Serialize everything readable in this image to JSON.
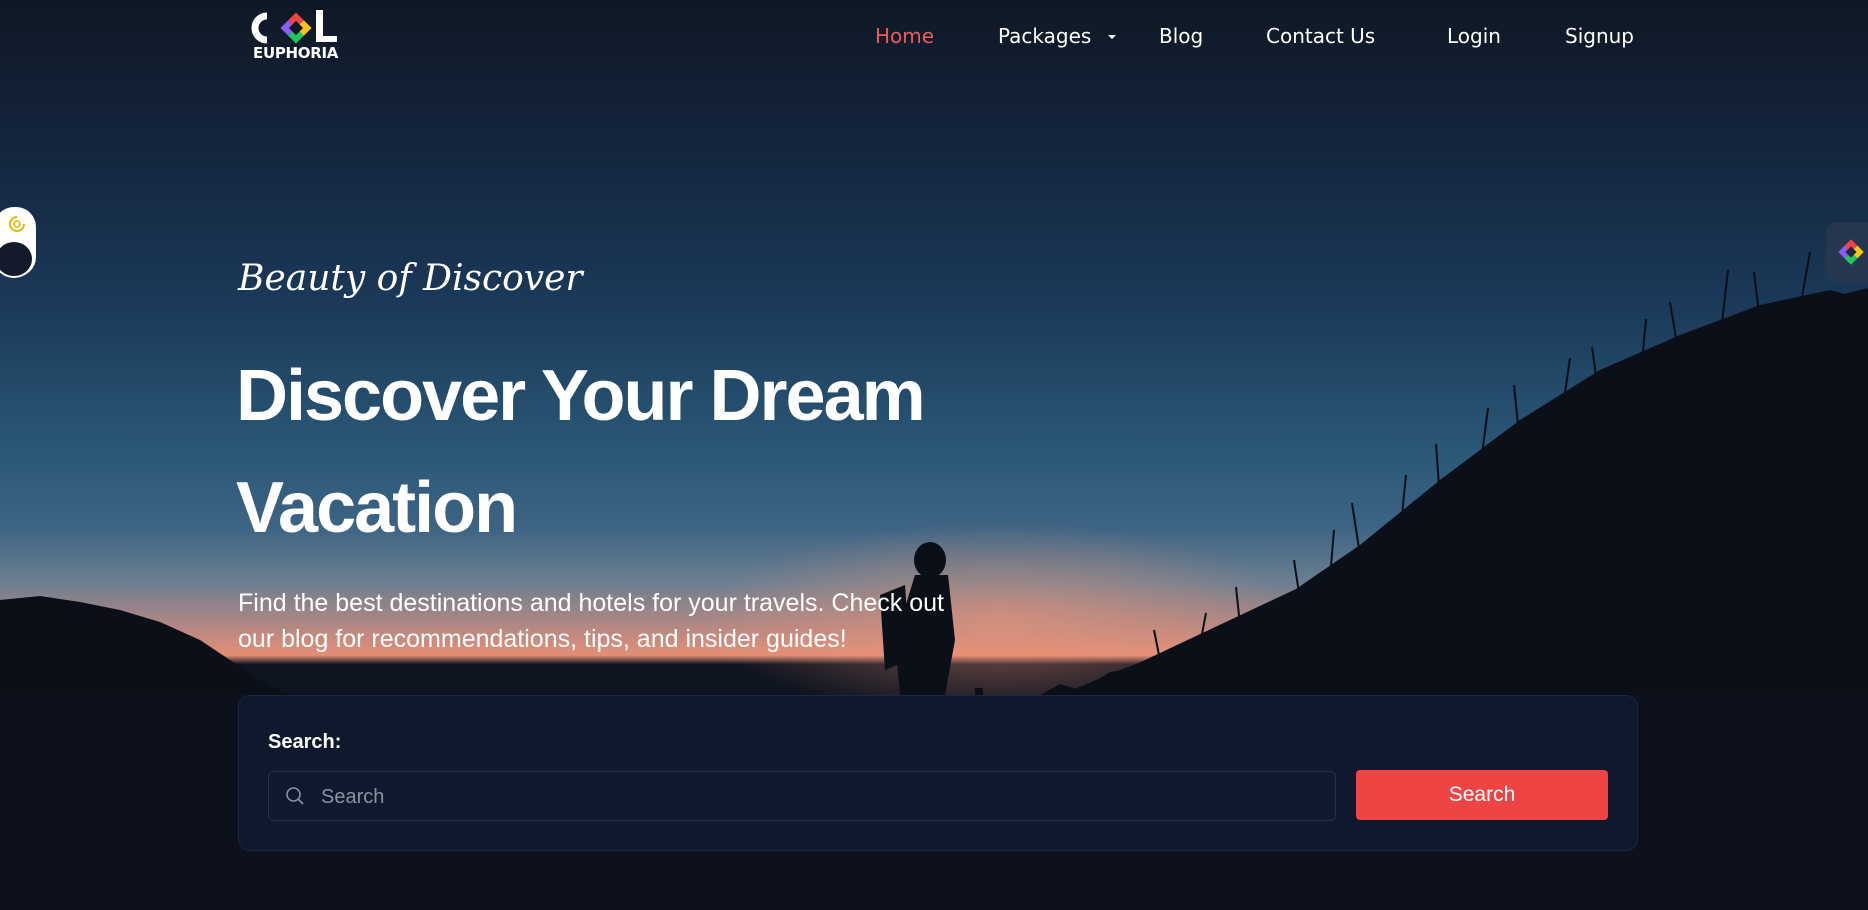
{
  "brand": {
    "logo_text": "EUPHORIA",
    "logo_alt": "COL"
  },
  "nav": {
    "items": [
      {
        "label": "Home",
        "active": true
      },
      {
        "label": "Packages",
        "has_dropdown": true
      },
      {
        "label": "Blog"
      },
      {
        "label": "Contact Us"
      },
      {
        "label": "Login"
      },
      {
        "label": "Signup"
      }
    ]
  },
  "hero": {
    "tagline": "Beauty of Discover",
    "headline": "Discover Your Dream Vacation",
    "subtitle": "Find the best destinations and hotels for your travels. Check out our blog for recommendations, tips, and insider guides!"
  },
  "search": {
    "label": "Search:",
    "placeholder": "Search",
    "button_label": "Search"
  },
  "colors": {
    "accent": "#ef4444",
    "active_nav": "#ef5a5a",
    "card_bg": "#0f182c"
  },
  "icons": {
    "theme_toggle": "sun-icon",
    "search": "search-icon",
    "side_widget": "diamond-logo-icon"
  }
}
